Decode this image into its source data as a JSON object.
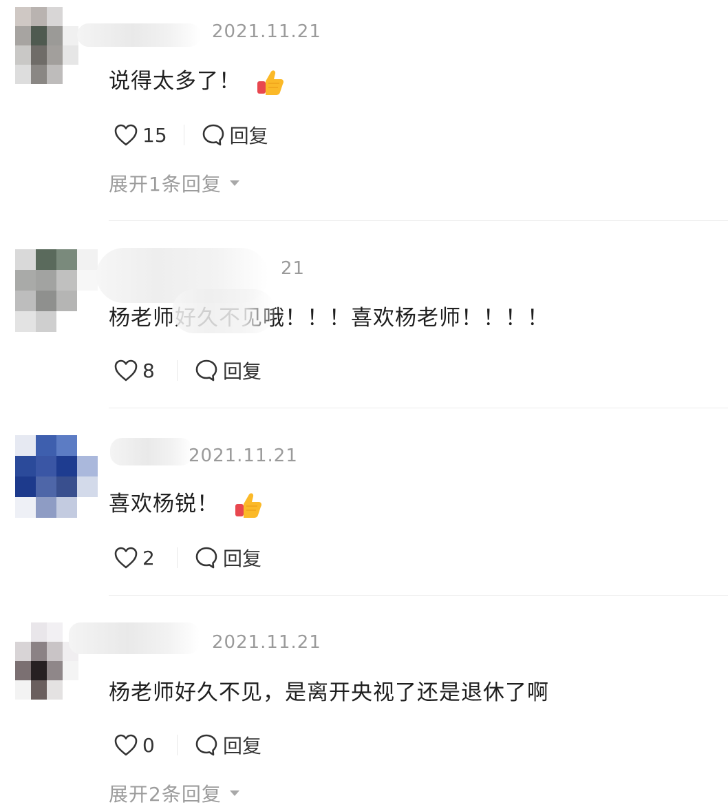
{
  "comments": [
    {
      "date": "2021.11.21",
      "text": "说得太多了！",
      "has_thumb": true,
      "likes": "15",
      "reply_label": "回复",
      "expand_label": "展开1条回复"
    },
    {
      "date": "21",
      "text": "杨老师好久不见哦！！！喜欢杨老师！！！！",
      "has_thumb": false,
      "likes": "8",
      "reply_label": "回复",
      "expand_label": ""
    },
    {
      "date": "2021.11.21",
      "text": "喜欢杨锐！",
      "has_thumb": true,
      "likes": "2",
      "reply_label": "回复",
      "expand_label": ""
    },
    {
      "date": "2021.11.21",
      "text": "杨老师好久不见，是离开央视了还是退休了啊",
      "has_thumb": false,
      "likes": "0",
      "reply_label": "回复",
      "expand_label": "展开2条回复"
    }
  ],
  "icons": {
    "like": "heart-outline-icon",
    "reply": "speech-bubble-icon",
    "thumb": "thumbs-up-emoji-icon",
    "expand": "caret-down-icon"
  },
  "colors": {
    "date_text": "#9a9a9a",
    "body_text": "#1f1f1f",
    "muted_text": "#9c9c9c",
    "divider": "#ececec"
  }
}
